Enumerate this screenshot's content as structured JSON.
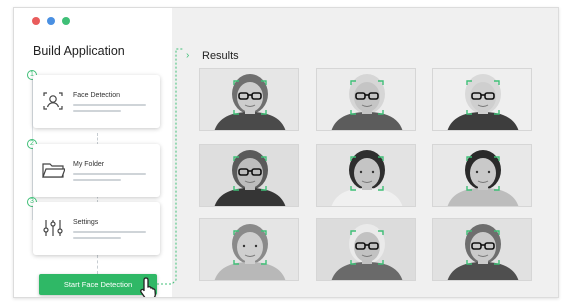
{
  "window": {
    "traffic_lights": [
      "#e95c5c",
      "#4a90e2",
      "#3fbf77"
    ]
  },
  "sidebar": {
    "title": "Build Application",
    "steps": [
      {
        "number": "1",
        "label": "Face Detection",
        "icon": "face-scan-icon"
      },
      {
        "number": "2",
        "label": "My Folder",
        "icon": "folder-icon"
      },
      {
        "number": "3",
        "label": "Settings",
        "icon": "sliders-icon"
      }
    ],
    "start_button": "Start Face Detection"
  },
  "results": {
    "title": "Results",
    "photos": [
      {
        "hair": "#6f6f6f",
        "skin": "#cdcdcd",
        "shirt": "#4a4a4a",
        "bg": "#e6e6e6",
        "glasses": true
      },
      {
        "hair": "#d6d6d6",
        "skin": "#c5c5c5",
        "shirt": "#5c5c5c",
        "bg": "#ececec",
        "glasses": true
      },
      {
        "hair": "#d9d9d9",
        "skin": "#cfcfcf",
        "shirt": "#3d3d3d",
        "bg": "#efefef",
        "glasses": true
      },
      {
        "hair": "#5a5a5a",
        "skin": "#bdbdbd",
        "shirt": "#353535",
        "bg": "#dedede",
        "glasses": true
      },
      {
        "hair": "#2e2e2e",
        "skin": "#c4c4c4",
        "shirt": "#f0f0f0",
        "bg": "#e3e3e3",
        "glasses": false
      },
      {
        "hair": "#2a2a2a",
        "skin": "#c9c9c9",
        "shirt": "#bdbdbd",
        "bg": "#e8e8e8",
        "glasses": false
      },
      {
        "hair": "#8a8a8a",
        "skin": "#cfcfcf",
        "shirt": "#b8b8b8",
        "bg": "#e5e5e5",
        "glasses": false
      },
      {
        "hair": "#eaeaea",
        "skin": "#c2c2c2",
        "shirt": "#6a6a6a",
        "bg": "#dcdcdc",
        "glasses": true
      },
      {
        "hair": "#6e6e6e",
        "skin": "#cacaca",
        "shirt": "#4f4f4f",
        "bg": "#e1e1e1",
        "glasses": true
      }
    ]
  },
  "accent_color": "#3fbf77"
}
